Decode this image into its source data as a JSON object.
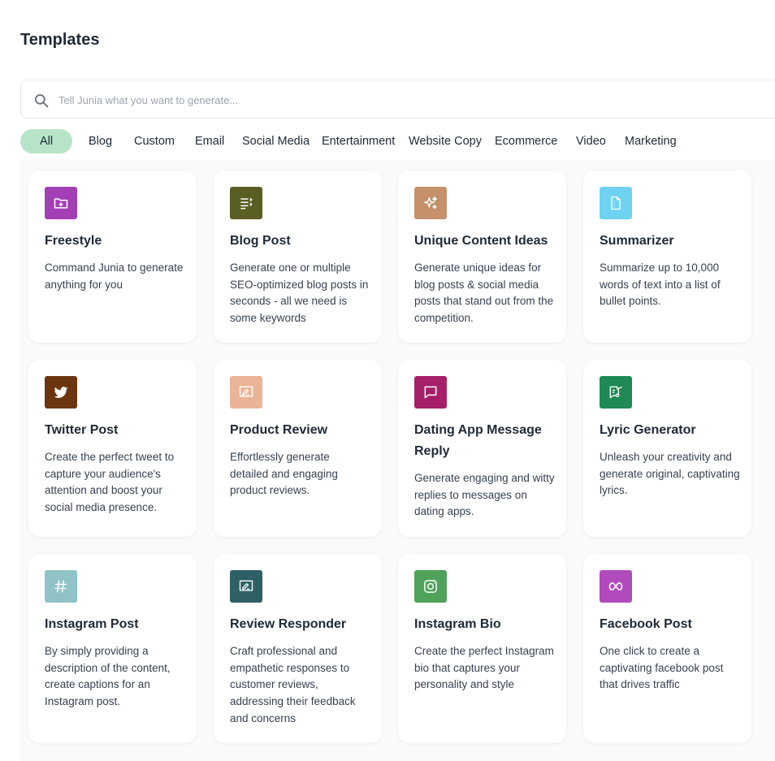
{
  "page_title": "Templates",
  "search": {
    "placeholder": "Tell Junia what you want to generate..."
  },
  "tabs": [
    "All",
    "Blog",
    "Custom",
    "Email",
    "Social Media",
    "Entertainment",
    "Website Copy",
    "Ecommerce",
    "Video",
    "Marketing"
  ],
  "cards": [
    {
      "title": "Freestyle",
      "description": "Command Junia to generate anything for you",
      "icon": "folder-plus-icon",
      "color": "#a33fb5"
    },
    {
      "title": "Blog Post",
      "description": "Generate one or multiple SEO-optimized blog posts in seconds - all we need is some keywords",
      "icon": "list-icon",
      "color": "#5a5e23"
    },
    {
      "title": "Unique Content Ideas",
      "description": "Generate unique ideas for blog posts & social media posts that stand out from the competition.",
      "icon": "sparkles-icon",
      "color": "#c4916a"
    },
    {
      "title": "Summarizer",
      "description": "Summarize up to 10,000 words of text into a list of bullet points.",
      "icon": "document-icon",
      "color": "#6ed3f0"
    },
    {
      "title": "Twitter Post",
      "description": "Create the perfect tweet to capture your audience's attention and boost your social media presence.",
      "icon": "twitter-icon",
      "color": "#6b3510"
    },
    {
      "title": "Product Review",
      "description": "Effortlessly generate detailed and engaging product reviews.",
      "icon": "review-icon",
      "color": "#eab497"
    },
    {
      "title": "Dating App Message Reply",
      "description": "Generate engaging and witty replies to messages on dating apps.",
      "icon": "message-icon",
      "color": "#a52068"
    },
    {
      "title": "Lyric Generator",
      "description": "Unleash your creativity and generate original, captivating lyrics.",
      "icon": "music-note-icon",
      "color": "#1f8a53"
    },
    {
      "title": "Instagram Post",
      "description": "By simply providing a description of the content, create captions for an Instagram post.",
      "icon": "hashtag-icon",
      "color": "#8fc3c5"
    },
    {
      "title": "Review Responder",
      "description": "Craft professional and empathetic responses to customer reviews, addressing their feedback and concerns",
      "icon": "review-reply-icon",
      "color": "#2e6166"
    },
    {
      "title": "Instagram Bio",
      "description": "Create the perfect Instagram bio that captures your personality and style",
      "icon": "instagram-icon",
      "color": "#4ea25a"
    },
    {
      "title": "Facebook Post",
      "description": "One click to create a captivating facebook post that drives traffic",
      "icon": "meta-icon",
      "color": "#b14bbd"
    }
  ]
}
